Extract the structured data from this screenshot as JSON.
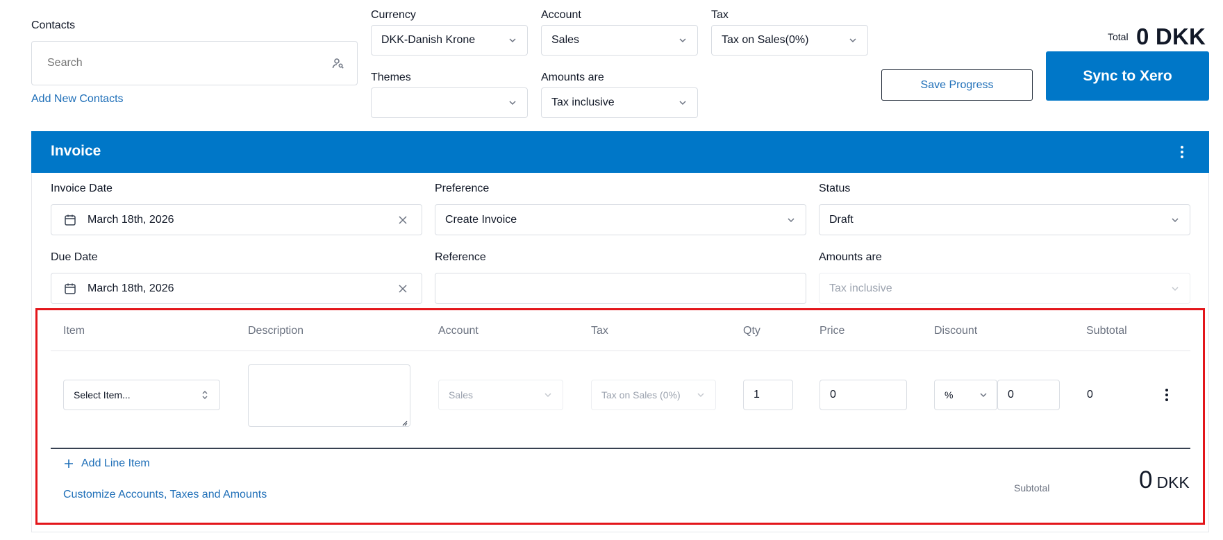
{
  "contacts": {
    "label": "Contacts",
    "search_placeholder": "Search",
    "add_link": "Add New Contacts"
  },
  "currency": {
    "label": "Currency",
    "value": "DKK-Danish Krone"
  },
  "account": {
    "label": "Account",
    "value": "Sales"
  },
  "tax": {
    "label": "Tax",
    "value": "Tax on Sales(0%)"
  },
  "themes": {
    "label": "Themes",
    "value": ""
  },
  "amounts_are": {
    "label": "Amounts are",
    "value": "Tax inclusive"
  },
  "total": {
    "label": "Total",
    "value": "0 DKK"
  },
  "buttons": {
    "save_progress": "Save Progress",
    "sync": "Sync to Xero"
  },
  "invoice": {
    "title": "Invoice",
    "invoice_date": {
      "label": "Invoice Date",
      "value": "March 18th, 2026"
    },
    "preference": {
      "label": "Preference",
      "value": "Create Invoice"
    },
    "status": {
      "label": "Status",
      "value": "Draft"
    },
    "due_date": {
      "label": "Due Date",
      "value": "March 18th, 2026"
    },
    "reference": {
      "label": "Reference",
      "value": ""
    },
    "amounts_are": {
      "label": "Amounts are",
      "value": "Tax inclusive"
    }
  },
  "line_items": {
    "columns": [
      "Item",
      "Description",
      "Account",
      "Tax",
      "Qty",
      "Price",
      "Discount",
      "Subtotal"
    ],
    "row": {
      "item_placeholder": "Select Item...",
      "description": "",
      "account": "Sales",
      "tax": "Tax on Sales (0%)",
      "qty": "1",
      "price": "0",
      "discount_type": "%",
      "discount_value": "0",
      "subtotal": "0"
    },
    "add_line": "Add Line Item",
    "customize": "Customize Accounts, Taxes and Amounts",
    "subtotal_label": "Subtotal",
    "subtotal_value": "0",
    "subtotal_currency": "DKK"
  },
  "colors": {
    "primary": "#0077c8",
    "link": "#1f6fb8",
    "highlight": "#e3161b"
  }
}
